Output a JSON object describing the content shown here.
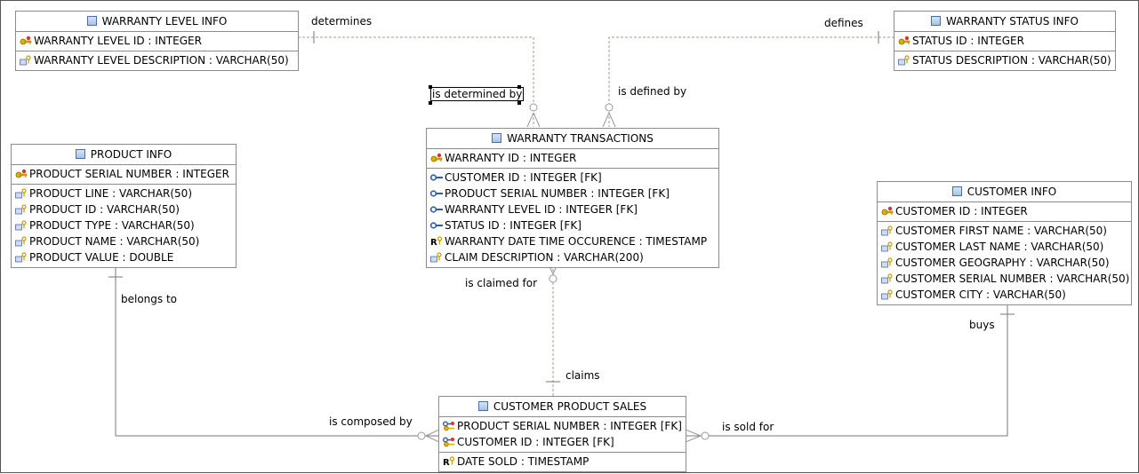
{
  "entities": {
    "warranty_level": {
      "title": "WARRANTY LEVEL INFO",
      "pk": [
        {
          "text": "WARRANTY LEVEL ID : INTEGER",
          "icon": "primary-key-icon"
        }
      ],
      "attrs": [
        {
          "text": "WARRANTY LEVEL DESCRIPTION : VARCHAR(50)",
          "icon": "attribute-icon"
        }
      ]
    },
    "warranty_status": {
      "title": "WARRANTY STATUS INFO",
      "pk": [
        {
          "text": "STATUS ID : INTEGER",
          "icon": "primary-key-icon"
        }
      ],
      "attrs": [
        {
          "text": "STATUS DESCRIPTION : VARCHAR(50)",
          "icon": "attribute-icon"
        }
      ]
    },
    "product": {
      "title": "PRODUCT INFO",
      "pk": [
        {
          "text": "PRODUCT SERIAL NUMBER : INTEGER",
          "icon": "primary-key-icon"
        }
      ],
      "attrs": [
        {
          "text": "PRODUCT LINE : VARCHAR(50)",
          "icon": "attribute-icon"
        },
        {
          "text": "PRODUCT ID : VARCHAR(50)",
          "icon": "attribute-icon"
        },
        {
          "text": "PRODUCT TYPE : VARCHAR(50)",
          "icon": "attribute-icon"
        },
        {
          "text": "PRODUCT NAME : VARCHAR(50)",
          "icon": "attribute-icon"
        },
        {
          "text": "PRODUCT VALUE : DOUBLE",
          "icon": "attribute-icon"
        }
      ]
    },
    "warranty_transactions": {
      "title": "WARRANTY TRANSACTIONS",
      "pk": [
        {
          "text": "WARRANTY ID : INTEGER",
          "icon": "primary-key-icon"
        }
      ],
      "attrs": [
        {
          "text": "CUSTOMER ID : INTEGER [FK]",
          "icon": "foreign-key-icon"
        },
        {
          "text": "PRODUCT SERIAL NUMBER : INTEGER [FK]",
          "icon": "foreign-key-icon"
        },
        {
          "text": "WARRANTY LEVEL ID : INTEGER [FK]",
          "icon": "foreign-key-icon"
        },
        {
          "text": "STATUS ID : INTEGER [FK]",
          "icon": "foreign-key-icon"
        },
        {
          "text": "WARRANTY DATE TIME OCCURENCE : TIMESTAMP",
          "icon": "required-attribute-icon"
        },
        {
          "text": "CLAIM DESCRIPTION : VARCHAR(200)",
          "icon": "attribute-icon"
        }
      ]
    },
    "customer": {
      "title": "CUSTOMER INFO",
      "pk": [
        {
          "text": "CUSTOMER ID : INTEGER",
          "icon": "primary-key-icon"
        }
      ],
      "attrs": [
        {
          "text": "CUSTOMER FIRST NAME : VARCHAR(50)",
          "icon": "attribute-icon"
        },
        {
          "text": "CUSTOMER LAST NAME : VARCHAR(50)",
          "icon": "attribute-icon"
        },
        {
          "text": "CUSTOMER GEOGRAPHY : VARCHAR(50)",
          "icon": "attribute-icon"
        },
        {
          "text": "CUSTOMER SERIAL NUMBER : VARCHAR(50)",
          "icon": "attribute-icon"
        },
        {
          "text": "CUSTOMER CITY : VARCHAR(50)",
          "icon": "attribute-icon"
        }
      ]
    },
    "customer_product_sales": {
      "title": "CUSTOMER PRODUCT SALES",
      "pk": [
        {
          "text": "PRODUCT SERIAL NUMBER : INTEGER [FK]",
          "icon": "primary-foreign-key-icon"
        },
        {
          "text": "CUSTOMER ID : INTEGER [FK]",
          "icon": "primary-foreign-key-icon"
        }
      ],
      "attrs": [
        {
          "text": "DATE SOLD : TIMESTAMP",
          "icon": "required-attribute-icon"
        }
      ]
    }
  },
  "labels": {
    "determines": "determines",
    "defines": "defines",
    "is_determined_by": "is determined by",
    "is_defined_by": "is defined by",
    "belongs_to": "belongs to",
    "is_claimed_for": "is claimed for",
    "claims": "claims",
    "buys": "buys",
    "is_composed_by": "is composed by",
    "is_sold_for": "is sold for"
  },
  "colors": {
    "key_gold": "#e0b000",
    "fk_blue": "#2f5aa8",
    "line_identifying": "#7a7a7a",
    "line_non_identifying": "#a89a8a"
  }
}
